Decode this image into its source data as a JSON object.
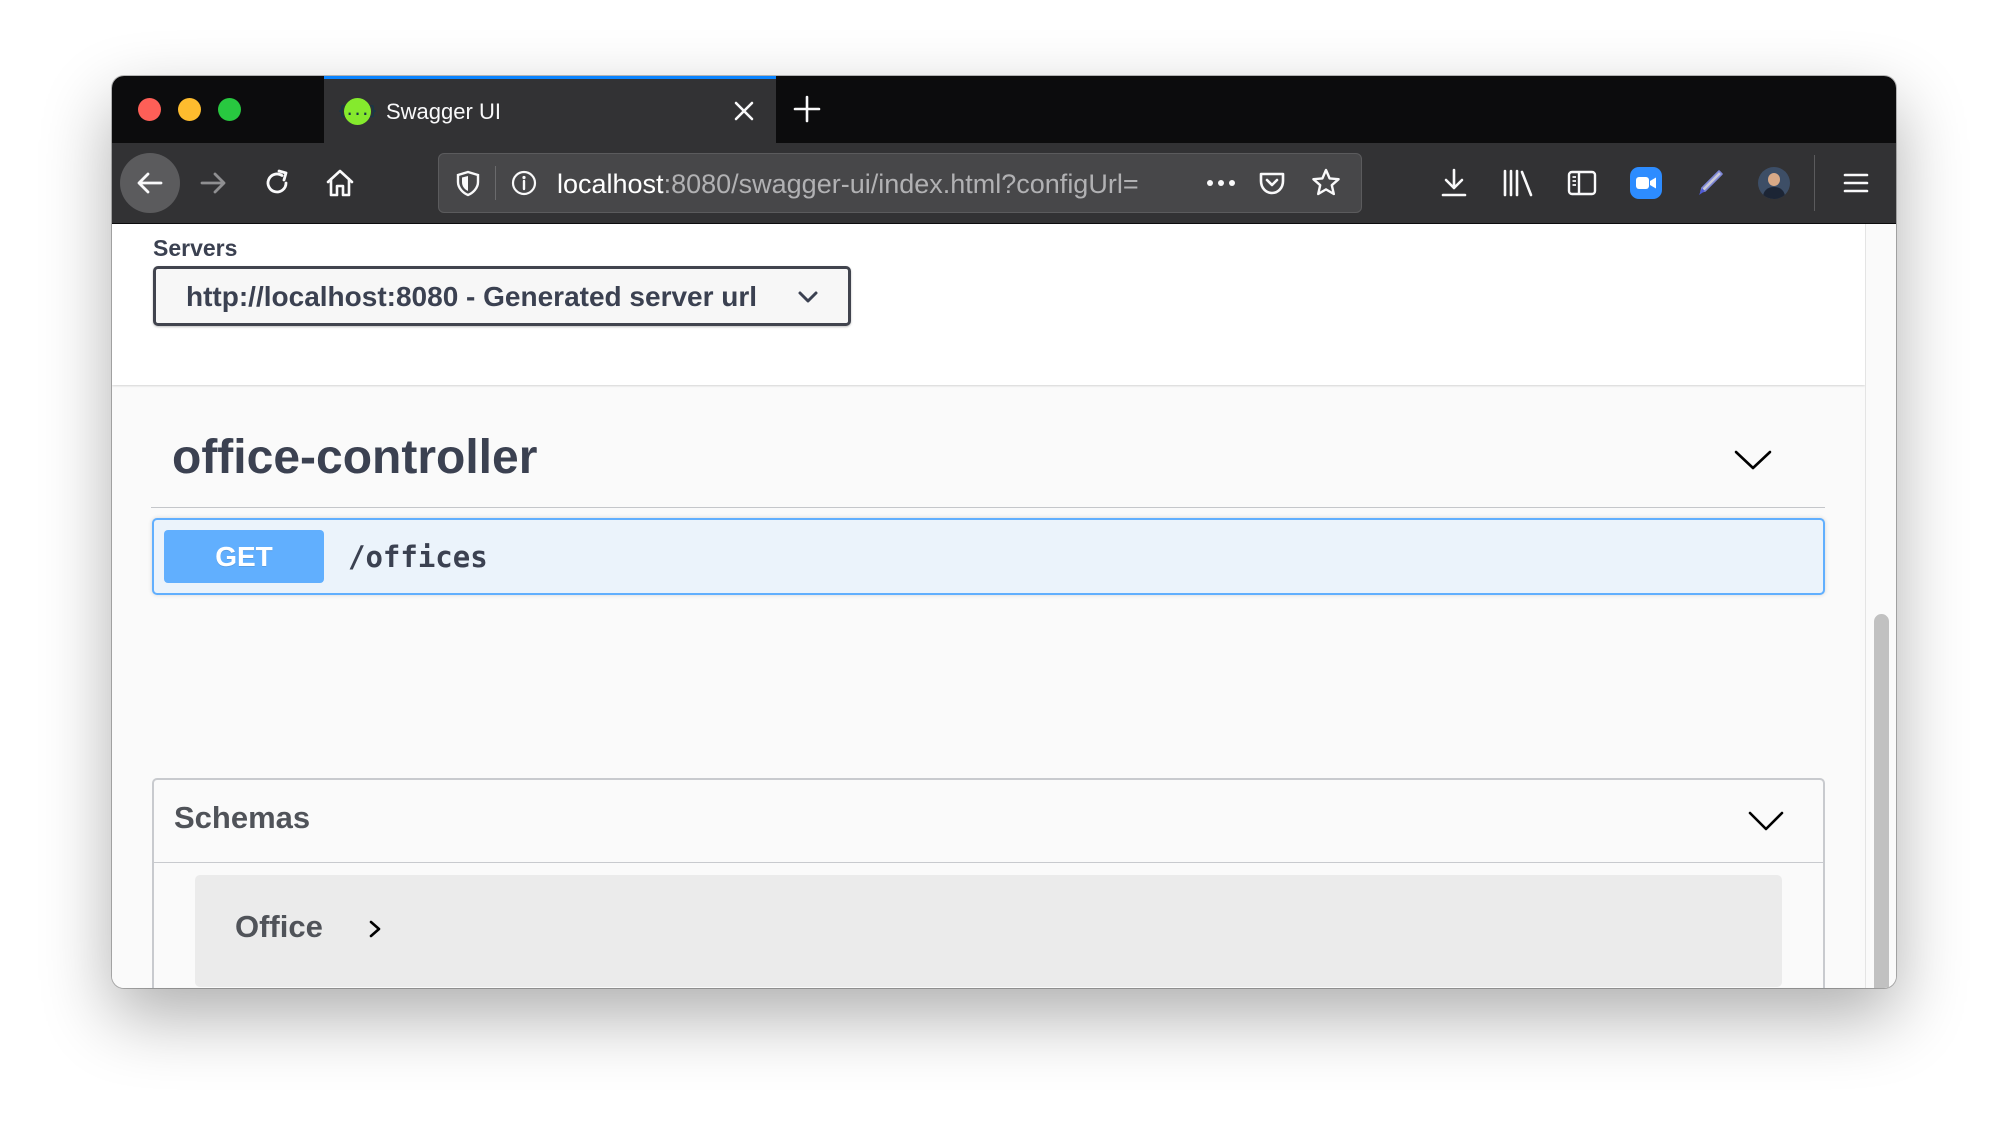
{
  "browser": {
    "tab": {
      "title": "Swagger UI",
      "favicon_glyph": "{...}",
      "favicon_color": "#85ea2d"
    },
    "url": {
      "host": "localhost",
      "rest": ":8080/swagger-ui/index.html?configUrl="
    },
    "toolbar_icons": [
      "back-icon",
      "forward-icon",
      "reload-icon",
      "home-icon",
      "shield-icon",
      "info-icon",
      "more-icon",
      "pocket-icon",
      "star-icon",
      "download-icon",
      "library-icon",
      "sidebar-icon",
      "zoom-icon",
      "pen-icon",
      "avatar",
      "hamburger-menu-icon"
    ],
    "accent_color": "#0a84ff"
  },
  "servers": {
    "label": "Servers",
    "selected": "http://localhost:8080 - Generated server url"
  },
  "tag": {
    "title": "office-controller"
  },
  "operation": {
    "method": "GET",
    "path": "/offices",
    "method_color": "#61affe"
  },
  "schemas": {
    "title": "Schemas",
    "models": [
      {
        "name": "Office"
      }
    ]
  }
}
